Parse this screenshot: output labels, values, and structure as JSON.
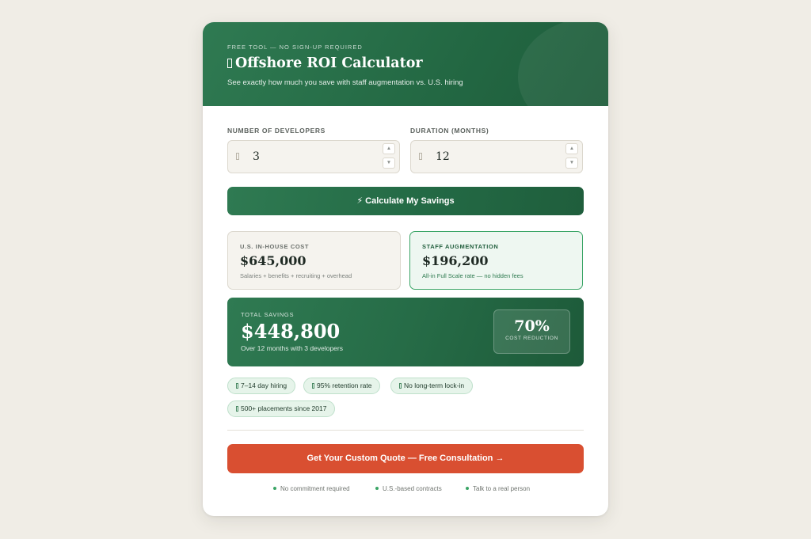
{
  "header": {
    "eyebrow": "FREE TOOL — NO SIGN-UP REQUIRED",
    "title": "Offshore ROI Calculator",
    "subtitle": "See exactly how much you save with staff augmentation vs. U.S. hiring"
  },
  "inputs": {
    "developers": {
      "label": "NUMBER OF DEVELOPERS",
      "value": "3"
    },
    "duration": {
      "label": "DURATION (MONTHS)",
      "value": "12"
    },
    "up_arrow": "▲",
    "down_arrow": "▼"
  },
  "calculate_button": {
    "label": "⚡ Calculate My Savings"
  },
  "costs": {
    "us": {
      "label": "U.S. IN-HOUSE COST",
      "amount": "$645,000",
      "note": "Salaries + benefits + recruiting + overhead"
    },
    "staff": {
      "label": "STAFF AUGMENTATION",
      "amount": "$196,200",
      "note": "All-in Full Scale rate — no hidden fees"
    }
  },
  "savings": {
    "label": "TOTAL SAVINGS",
    "amount": "$448,800",
    "note": "Over 12 months with 3 developers",
    "percent": "70%",
    "percent_label": "COST REDUCTION"
  },
  "pills": [
    "7–14 day hiring",
    "95% retention rate",
    "No long-term lock-in",
    "500+ placements since 2017"
  ],
  "quote_button": {
    "label": "Get Your Custom Quote — Free Consultation →"
  },
  "trust": [
    "No commitment required",
    "U.S.-based contracts",
    "Talk to a real person"
  ],
  "colors": {
    "brand_green": "#2f7a52",
    "accent_orange": "#d94f31",
    "background": "#f0ede6"
  }
}
